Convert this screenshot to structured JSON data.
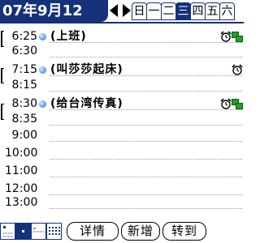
{
  "header": {
    "date": "07年9月12",
    "weekdays": [
      "日",
      "一",
      "二",
      "三",
      "四",
      "五",
      "六"
    ],
    "selected_weekday_index": 3,
    "accent_color": "#14317a"
  },
  "timeline": {
    "rows": [
      {
        "time": "6:25",
        "event": "(上班)",
        "has_dot": true,
        "icons": [
          "alarm-icon",
          "repeat-icon"
        ]
      },
      {
        "time": "6:30",
        "event": "",
        "has_dot": false,
        "icons": []
      },
      {
        "time": "7:15",
        "event": "(叫莎莎起床)",
        "has_dot": true,
        "icons": [
          "alarm-icon"
        ]
      },
      {
        "time": "8:15",
        "event": "",
        "has_dot": false,
        "icons": []
      },
      {
        "time": "8:30",
        "event": "(给台湾传真)",
        "has_dot": true,
        "icons": [
          "alarm-icon",
          "repeat-icon"
        ]
      },
      {
        "time": "8:35",
        "event": "",
        "has_dot": false,
        "icons": []
      },
      {
        "time": "9:00",
        "event": "",
        "has_dot": false,
        "icons": []
      },
      {
        "time": "10:00",
        "event": "",
        "has_dot": false,
        "icons": []
      },
      {
        "time": "11:00",
        "event": "",
        "has_dot": false,
        "icons": []
      },
      {
        "time": "12:00",
        "event": "",
        "has_dot": false,
        "icons": []
      },
      {
        "time": "13:00",
        "event": "",
        "has_dot": false,
        "icons": []
      }
    ]
  },
  "bottom": {
    "view_icons": [
      "day-view-icon",
      "week-view-icon",
      "list-view-icon",
      "month-view-icon"
    ],
    "selected_view_index": 1,
    "details_label": "详情",
    "new_label": "新增",
    "goto_label": "转到"
  }
}
